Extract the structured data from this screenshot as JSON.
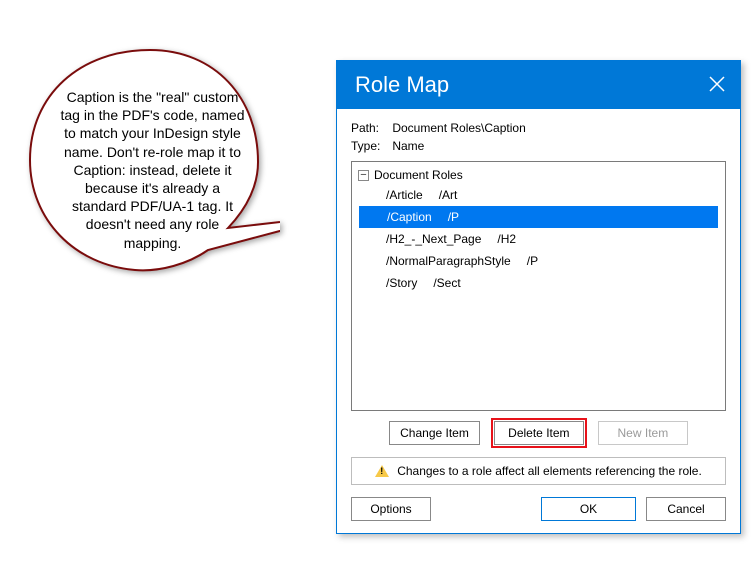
{
  "callout": {
    "text": "Caption is the \"real\" custom tag in the PDF's code, named to match your InDesign style name. Don't re-role map it to Caption: instead, delete it because it's already a standard PDF/UA-1 tag. It doesn't need any role mapping."
  },
  "dialog": {
    "title": "Role Map",
    "path_label": "Path:",
    "path_value": "Document Roles\\Caption",
    "type_label": "Type:",
    "type_value": "Name",
    "tree": {
      "root": "Document Roles",
      "rows": [
        {
          "key": "/Article",
          "val": "/Art",
          "selected": false
        },
        {
          "key": "/Caption",
          "val": "/P",
          "selected": true
        },
        {
          "key": "/H2_-_Next_Page",
          "val": "/H2",
          "selected": false
        },
        {
          "key": "/NormalParagraphStyle",
          "val": "/P",
          "selected": false
        },
        {
          "key": "/Story",
          "val": "/Sect",
          "selected": false
        }
      ]
    },
    "buttons": {
      "change": "Change Item",
      "delete": "Delete Item",
      "new": "New Item"
    },
    "notice": "Changes to a role affect all elements referencing the role.",
    "footer": {
      "options": "Options",
      "ok": "OK",
      "cancel": "Cancel"
    }
  }
}
